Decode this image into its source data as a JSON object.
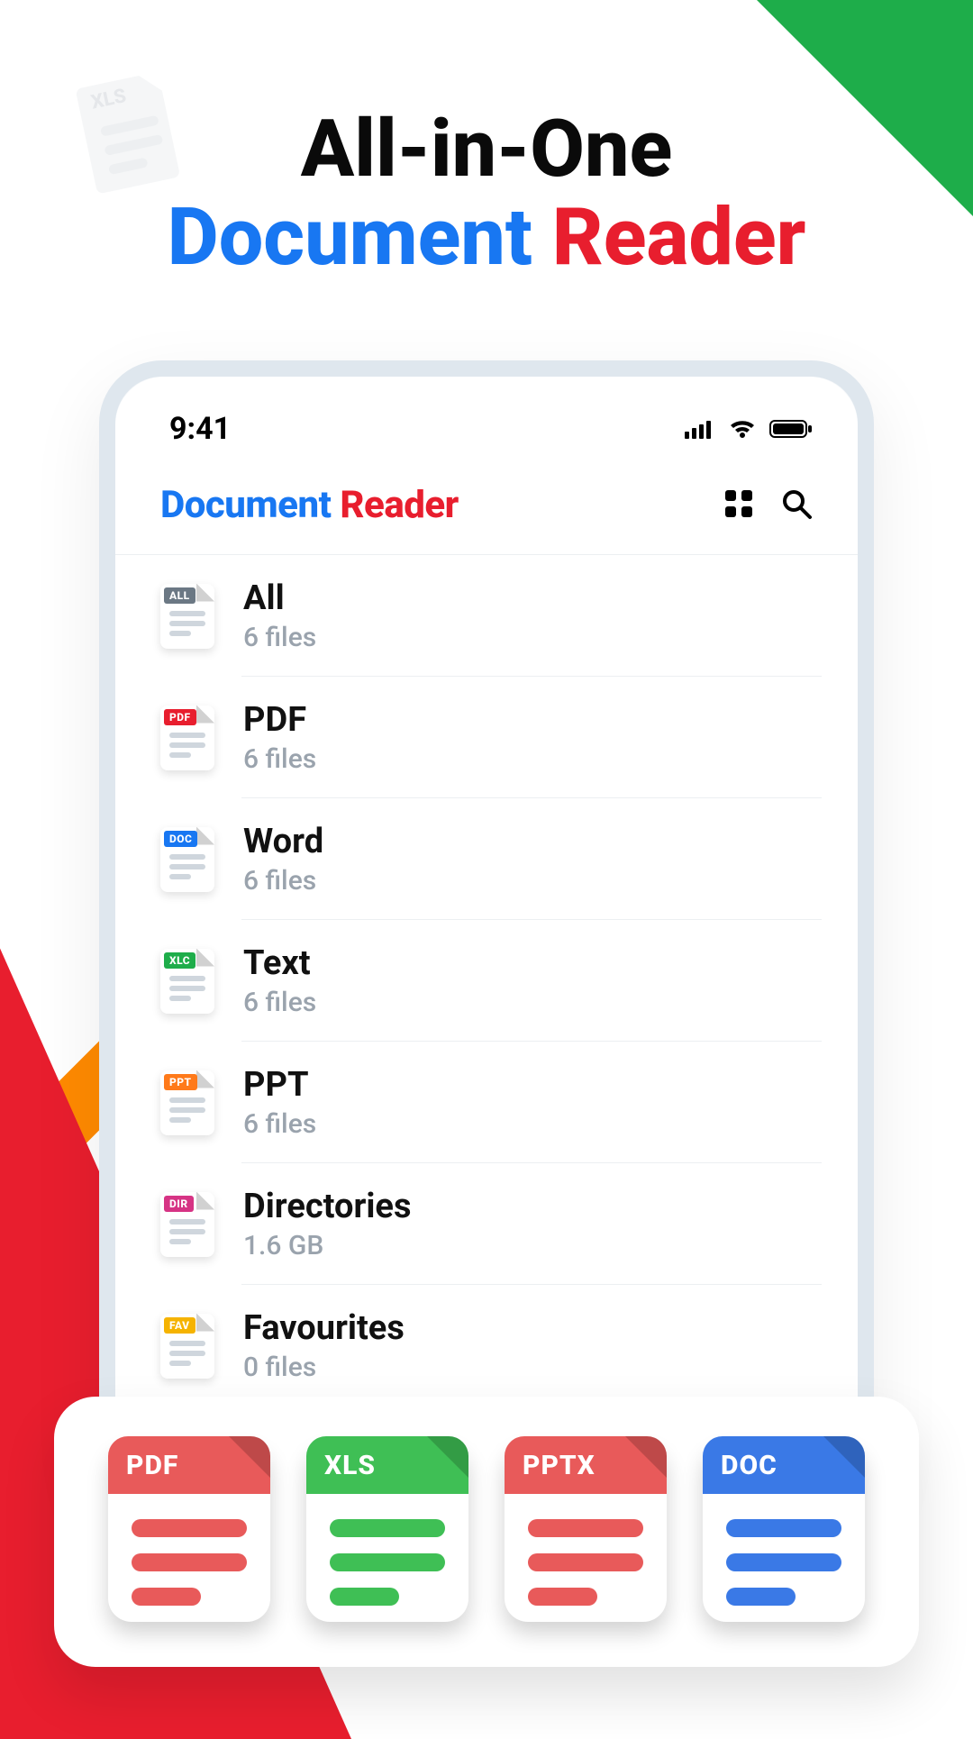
{
  "colors": {
    "blue": "#1877f2",
    "red": "#e81e2e",
    "green": "#1ead4a",
    "orange": "#ff8a00",
    "doc_blue": "#3a79e6",
    "xls_green": "#34b54a",
    "ppt_orange": "#ff7a1a",
    "dir_pink": "#d63384",
    "fav_yellow": "#f5b301"
  },
  "headline": {
    "line1": "All-in-One",
    "line2_left": "Document",
    "line2_right": "Reader"
  },
  "statusbar": {
    "time": "9:41"
  },
  "app_header": {
    "title_left": "Document",
    "title_right": "Reader"
  },
  "categories": [
    {
      "icon": "all",
      "tag": "ALL",
      "tag_bg": "#6b7884",
      "title": "All",
      "sub": "6 files"
    },
    {
      "icon": "pdf",
      "tag": "PDF",
      "tag_bg": "#e81e2e",
      "title": "PDF",
      "sub": "6 files"
    },
    {
      "icon": "doc",
      "tag": "DOC",
      "tag_bg": "#1877f2",
      "title": "Word",
      "sub": "6 files"
    },
    {
      "icon": "xlc",
      "tag": "XLC",
      "tag_bg": "#1ead4a",
      "title": "Text",
      "sub": "6 files"
    },
    {
      "icon": "ppt",
      "tag": "PPT",
      "tag_bg": "#ff7a1a",
      "title": "PPT",
      "sub": "6 files"
    },
    {
      "icon": "dir",
      "tag": "DIR",
      "tag_bg": "#d63384",
      "title": "Directories",
      "sub": "1.6 GB"
    },
    {
      "icon": "fav",
      "tag": "FAV",
      "tag_bg": "#f5b301",
      "title": "Favourites",
      "sub": "0 files"
    }
  ],
  "bottom_icons": [
    {
      "label": "PDF",
      "color": "#e85a5a",
      "line": "#e85a5a"
    },
    {
      "label": "XLS",
      "color": "#3fbf55",
      "line": "#3fbf55"
    },
    {
      "label": "PPTX",
      "color": "#e85a5a",
      "line": "#e85a5a"
    },
    {
      "label": "DOC",
      "color": "#3a79e6",
      "line": "#3a79e6"
    }
  ]
}
